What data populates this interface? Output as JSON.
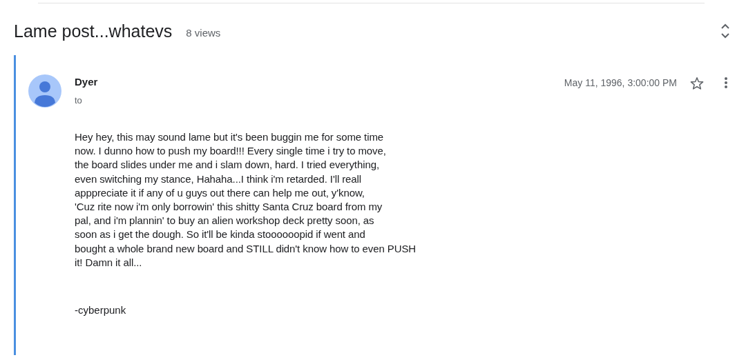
{
  "thread": {
    "title": "Lame post...whatevs",
    "views": "8 views"
  },
  "message": {
    "author": "Dyer",
    "recipient_label": "to",
    "date": "May 11, 1996, 3:00:00 PM",
    "starred": false,
    "body_lines": [
      "Hey hey, this may sound lame but it's been buggin me for some time",
      "now. I dunno how to push my board!!! Every single time i try to move,",
      "the board slides under me and i slam down, hard. I tried everything,",
      "even switching my stance, Hahaha...I think i'm retarded. I'll reall",
      "apppreciate it if any of u guys out there can help me out, y'know,",
      "'Cuz rite now i'm only borrowin' this shitty Santa Cruz board from my",
      "pal, and i'm plannin' to buy an alien workshop deck pretty soon, as",
      "soon as i get the dough. So it'll be kinda stoooooopid if went and",
      "bought a whole brand new board and STILL didn't know how to even PUSH",
      "it! Damn it all..."
    ],
    "signature": "-cyberpunk"
  }
}
